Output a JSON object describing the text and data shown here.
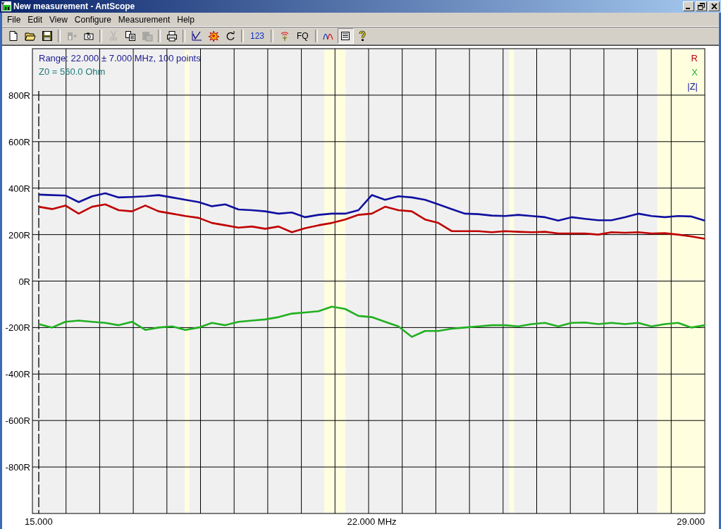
{
  "window": {
    "title": "New measurement - AntScope"
  },
  "menu": [
    {
      "label": "File"
    },
    {
      "label": "Edit"
    },
    {
      "label": "View"
    },
    {
      "label": "Configure"
    },
    {
      "label": "Measurement"
    },
    {
      "label": "Help"
    }
  ],
  "toolbar": [
    {
      "kind": "icon",
      "disabled": false,
      "selected": false
    },
    {
      "kind": "icon",
      "disabled": false,
      "selected": false
    },
    {
      "kind": "icon",
      "disabled": false,
      "selected": false
    },
    {
      "kind": "separator"
    },
    {
      "kind": "icon",
      "disabled": true,
      "selected": false
    },
    {
      "kind": "icon",
      "disabled": false,
      "selected": false
    },
    {
      "kind": "separator"
    },
    {
      "kind": "icon",
      "disabled": true,
      "selected": false
    },
    {
      "kind": "icon",
      "disabled": false,
      "selected": false
    },
    {
      "kind": "icon",
      "disabled": true,
      "selected": false
    },
    {
      "kind": "separator"
    },
    {
      "kind": "icon",
      "disabled": false,
      "selected": false
    },
    {
      "kind": "separator"
    },
    {
      "kind": "icon",
      "disabled": false,
      "selected": false
    },
    {
      "kind": "icon",
      "disabled": false,
      "selected": false
    },
    {
      "kind": "icon",
      "disabled": false,
      "selected": false
    },
    {
      "kind": "separator"
    },
    {
      "kind": "text",
      "label": "123",
      "selected": false
    },
    {
      "kind": "separator"
    },
    {
      "kind": "icon",
      "disabled": false,
      "selected": false
    },
    {
      "kind": "text",
      "label": "FQ",
      "selected": false
    },
    {
      "kind": "separator"
    },
    {
      "kind": "icon",
      "disabled": false,
      "selected": false
    },
    {
      "kind": "icon",
      "disabled": false,
      "selected": true
    },
    {
      "kind": "icon",
      "disabled": false,
      "selected": false
    }
  ],
  "chart": {
    "range_text": "Range: 22.000 ± 7.000 MHz, 100 points",
    "z0_text": "Z0 = 560.0 Ohm",
    "chart_data": {
      "type": "line",
      "x": [
        15,
        15.28,
        15.56,
        15.84,
        16.12,
        16.4,
        16.68,
        16.96,
        17.24,
        17.52,
        17.8,
        18.08,
        18.36,
        18.64,
        18.92,
        19.2,
        19.48,
        19.76,
        20.04,
        20.32,
        20.6,
        20.88,
        21.16,
        21.44,
        21.72,
        22,
        22.28,
        22.56,
        22.84,
        23.12,
        23.4,
        23.68,
        23.96,
        24.24,
        24.52,
        24.8,
        25.08,
        25.36,
        25.64,
        25.92,
        26.2,
        26.48,
        26.76,
        27.04,
        27.32,
        27.6,
        27.88,
        28.16,
        28.44,
        28.72,
        29
      ],
      "series": [
        {
          "name": "R",
          "color": "#c00000",
          "values": [
            320,
            310,
            325,
            290,
            320,
            330,
            305,
            300,
            325,
            300,
            290,
            280,
            272,
            250,
            240,
            230,
            235,
            225,
            235,
            210,
            228,
            240,
            250,
            265,
            285,
            290,
            320,
            305,
            300,
            265,
            250,
            215,
            215,
            215,
            210,
            215,
            212,
            210,
            212,
            205,
            205,
            205,
            200,
            210,
            208,
            210,
            205,
            206,
            200,
            192,
            182
          ]
        },
        {
          "name": "X",
          "color": "#20b020",
          "values": [
            -185,
            -200,
            -175,
            -170,
            -175,
            -180,
            -190,
            -175,
            -210,
            -200,
            -195,
            -210,
            -200,
            -180,
            -190,
            -175,
            -170,
            -165,
            -155,
            -140,
            -135,
            -130,
            -110,
            -120,
            -150,
            -155,
            -175,
            -195,
            -240,
            -215,
            -215,
            -205,
            -200,
            -195,
            -190,
            -190,
            -195,
            -185,
            -180,
            -195,
            -180,
            -178,
            -185,
            -180,
            -185,
            -180,
            -195,
            -185,
            -180,
            -200,
            -190
          ]
        },
        {
          "name": "|Z|",
          "color": "#1010a0",
          "values": [
            372,
            370,
            368,
            340,
            365,
            378,
            360,
            362,
            365,
            370,
            360,
            350,
            340,
            322,
            330,
            308,
            305,
            300,
            290,
            295,
            275,
            285,
            290,
            290,
            305,
            370,
            350,
            365,
            360,
            350,
            330,
            310,
            290,
            288,
            282,
            280,
            285,
            280,
            275,
            260,
            275,
            268,
            262,
            262,
            275,
            290,
            280,
            275,
            280,
            278,
            260
          ]
        }
      ],
      "xlim": [
        14.867,
        29
      ],
      "ylim": [
        -1000,
        1000
      ],
      "xticks": [
        {
          "value": 15,
          "label": "15.000"
        },
        {
          "value": 22,
          "label": "22.000 MHz"
        },
        {
          "value": 29,
          "label": "29.000"
        }
      ],
      "yticks": [
        {
          "value": 800,
          "label": "800R"
        },
        {
          "value": 600,
          "label": "600R"
        },
        {
          "value": 400,
          "label": "400R"
        },
        {
          "value": 200,
          "label": "200R"
        },
        {
          "value": 0,
          "label": "0R"
        },
        {
          "value": -200,
          "label": "-200R"
        },
        {
          "value": -400,
          "label": "-400R"
        },
        {
          "value": -600,
          "label": "-600R"
        },
        {
          "value": -800,
          "label": "-800R"
        }
      ],
      "grid": true,
      "bands": [
        {
          "axis": "x",
          "from": 18.068,
          "to": 18.168
        },
        {
          "axis": "x",
          "from": 21.0,
          "to": 21.45
        },
        {
          "axis": "x",
          "from": 24.89,
          "to": 24.99
        },
        {
          "axis": "x",
          "from": 28.0,
          "to": 29.0
        }
      ],
      "ref_lines": [
        {
          "axis": "x",
          "value": 15
        }
      ]
    }
  }
}
